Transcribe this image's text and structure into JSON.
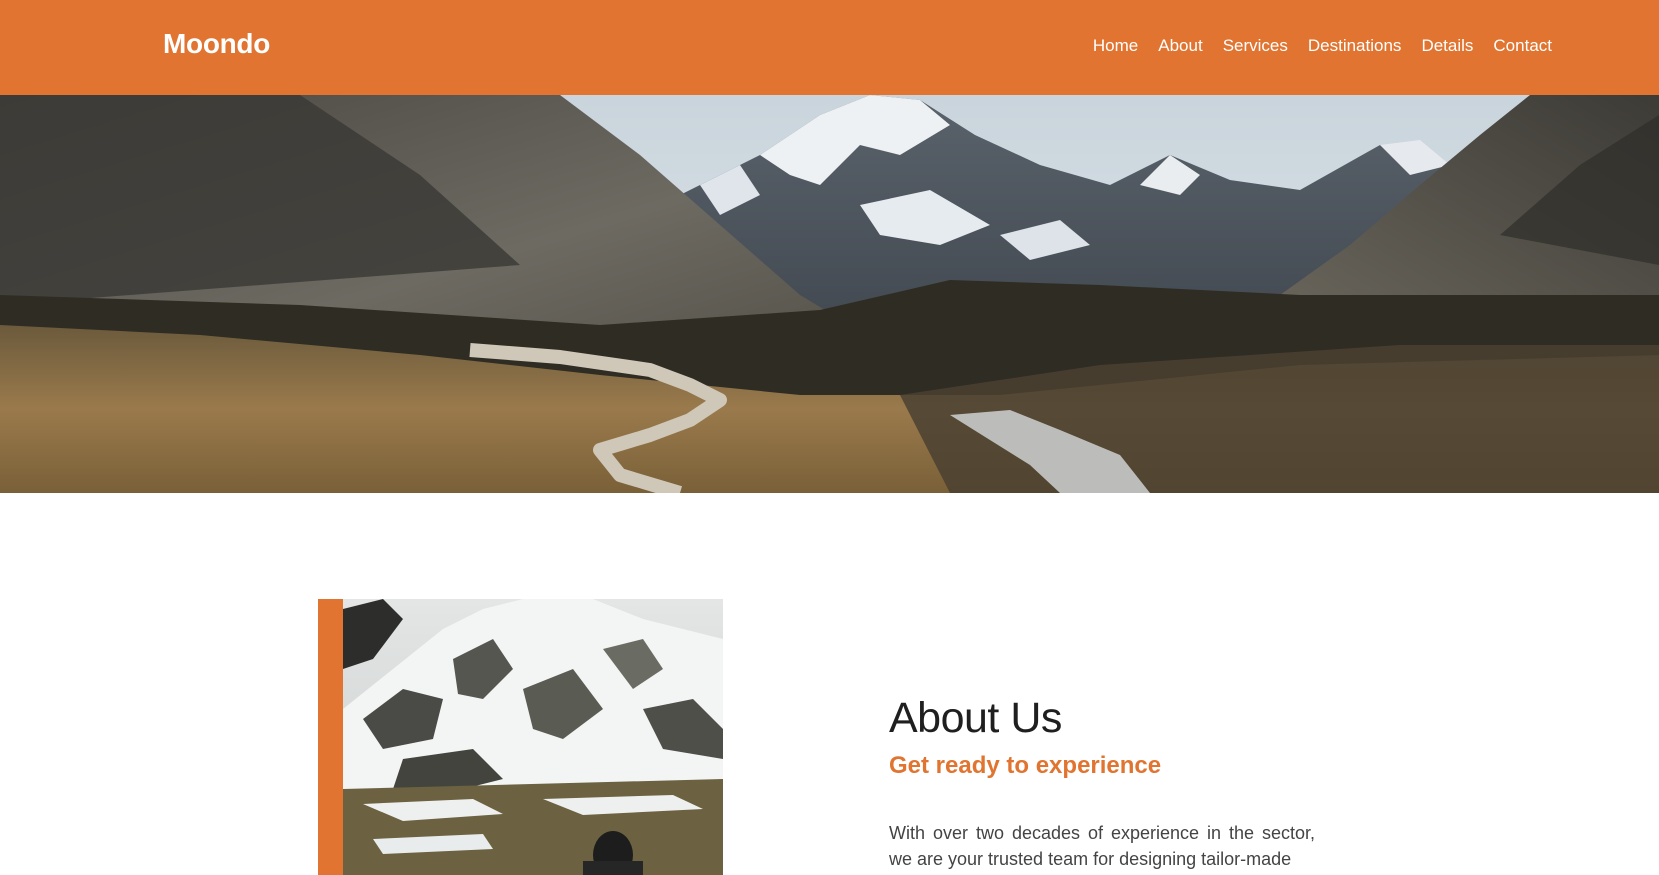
{
  "header": {
    "brand": "Moondo",
    "nav": [
      {
        "label": "Home"
      },
      {
        "label": "About"
      },
      {
        "label": "Services"
      },
      {
        "label": "Destinations"
      },
      {
        "label": "Details"
      },
      {
        "label": "Contact"
      }
    ]
  },
  "hero": {
    "image": "mountain-valley-boardwalk-photo"
  },
  "about": {
    "image": "snowy-hillside-hiker-photo",
    "title": "About Us",
    "subtitle": "Get ready to experience",
    "body": "With over two decades of experience in the sector, we are your trusted team for designing tailor-made"
  },
  "colors": {
    "accent": "#e07430",
    "heading": "#1f1f1f",
    "body_text": "#444444"
  }
}
